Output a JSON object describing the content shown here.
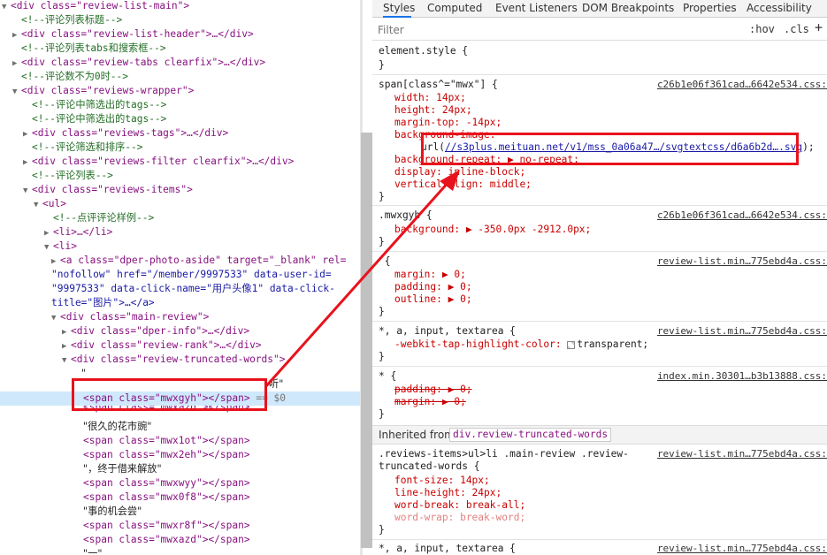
{
  "elements_panel": {
    "lines": [
      {
        "indent": 0,
        "tri": "▼",
        "html": "<div class=\"review-list-main\">"
      },
      {
        "indent": 1,
        "tri": "",
        "cmt": "<!--评论列表标题-->"
      },
      {
        "indent": 1,
        "tri": "▶",
        "html": "<div class=\"review-list-header\">…</div>"
      },
      {
        "indent": 1,
        "tri": "",
        "cmt": "<!--评论列表tabs和搜索框-->"
      },
      {
        "indent": 1,
        "tri": "▶",
        "html": "<div class=\"review-tabs clearfix\">…</div>"
      },
      {
        "indent": 1,
        "tri": "",
        "cmt": "<!--评论数不为0时-->"
      },
      {
        "indent": 1,
        "tri": "▼",
        "html": "<div class=\"reviews-wrapper\">"
      },
      {
        "indent": 2,
        "tri": "",
        "cmt": "<!--评论中筛选出的tags-->"
      },
      {
        "indent": 2,
        "tri": "",
        "cmt": "<!--评论中筛选出的tags-->"
      },
      {
        "indent": 2,
        "tri": "▶",
        "html": "<div class=\"reviews-tags\">…</div>"
      },
      {
        "indent": 2,
        "tri": "",
        "cmt": "<!--评论筛选和排序-->"
      },
      {
        "indent": 2,
        "tri": "▶",
        "html": "<div class=\"reviews-filter clearfix\">…</div>"
      },
      {
        "indent": 2,
        "tri": "",
        "cmt": "<!--评论列表-->"
      },
      {
        "indent": 2,
        "tri": "▼",
        "html": "<div class=\"reviews-items\">"
      },
      {
        "indent": 3,
        "tri": "▼",
        "html": "<ul>"
      },
      {
        "indent": 4,
        "tri": "",
        "cmt": "<!--点评评论样例-->"
      },
      {
        "indent": 4,
        "tri": "▶",
        "html": "<li>…</li>"
      },
      {
        "indent": 4,
        "tri": "▼",
        "html": "<li>"
      }
    ],
    "anchor_line1": "<a class=\"dper-photo-aside\" target=\"_blank\" rel=",
    "anchor_line2": "\"nofollow\" href=\"/member/9997533\" data-user-id=",
    "anchor_line3": "\"9997533\" data-click-name=\"用户头像1\" data-click-",
    "anchor_line4": "title=\"图片\">…</a>",
    "main_review": "<div class=\"main-review\">",
    "dper_info": "<div class=\"dper-info\">…</div>",
    "review_rank": "<div class=\"review-rank\">…</div>",
    "review_truncated": "<div class=\"review-truncated-words\">",
    "quote_open": "\"",
    "ting": "听\"",
    "selected_span": "<span class=\"mwxgyh\"></span>",
    "selected_suffix": " == $0",
    "faded_span": "<span class=\"mwxazd\"></span>",
    "text1": "\"很久的花市豌\"",
    "span1": "<span class=\"mwx1ot\"></span>",
    "span2": "<span class=\"mwx2eh\"></span>",
    "text2": "\"，终于借来解放\"",
    "span3": "<span class=\"mwxwyy\"></span>",
    "span4": "<span class=\"mwx0f8\"></span>",
    "text3": "\"事的机会尝\"",
    "span5": "<span class=\"mwxr8f\"></span>",
    "span6": "<span class=\"mwxazd\"></span>",
    "text4": "\"一\""
  },
  "styles_panel": {
    "tabs": [
      "Styles",
      "Computed",
      "Event Listeners",
      "DOM Breakpoints",
      "Properties",
      "Accessibility"
    ],
    "filter_placeholder": "Filter",
    "hov": ":hov",
    "cls": ".cls",
    "plus": "+",
    "element_style": "element.style {",
    "close": "}",
    "rule1_selector": "span[class^=\"mwx\"] {",
    "rule1_src": "c26b1e06f361cad…6642e534.css:",
    "width": "width: 14px;",
    "height": "height: 24px;",
    "margin_top": "margin-top: -14px;",
    "bg_image": "background-image:",
    "url_pre": "url(",
    "url_link": "//s3plus.meituan.net/v1/mss_0a06a47…/svgtextcss/d6a6b2d….svg",
    "url_post": ");",
    "bg_repeat": "background-repeat: ▶ no-repeat;",
    "display": "display: inline-block;",
    "valign": "vertical-align: middle;",
    "rule2_selector": ".mwxgyh {",
    "rule2_src": "c26b1e06f361cad…6642e534.css:",
    "bg": "background: ▶ -350.0px -2912.0px;",
    "rule3_selector": " {",
    "rule3_src": "review-list.min…775ebd4a.css:",
    "margin": "margin: ▶ 0;",
    "padding": "padding: ▶ 0;",
    "outline": "outline: ▶ 0;",
    "rule4_selector": "*, a, input, textarea {",
    "rule4_src": "review-list.min…775ebd4a.css:",
    "tap": "-webkit-tap-highlight-color:",
    "tap_val": "transparent;",
    "rule5_selector": "* {",
    "rule5_src": "index.min.30301…b3b13888.css:",
    "padding_s": "padding: ▶ 0;",
    "margin_s": "margin: ▶ 0;",
    "inherited_label": "Inherited from",
    "inherited_sel": "div.review-truncated-words",
    "rule6_selector1": ".reviews-items>ul>li .main-review .review-",
    "rule6_selector2": "truncated-words {",
    "rule6_src": "review-list.min…775ebd4a.css:",
    "font_size": "font-size: 14px;",
    "line_height": "line-height: 24px;",
    "word_break": "word-break: break-all;",
    "word_wrap": "word-wrap: break-word;",
    "rule7_selector": "*, a, input, textarea {",
    "rule7_src": "review-list.min…775ebd4a.css:"
  },
  "colors": {
    "highlight": "#e8121c",
    "selection": "#cfe8fc",
    "tag": "#881280",
    "attr": "#994500"
  }
}
